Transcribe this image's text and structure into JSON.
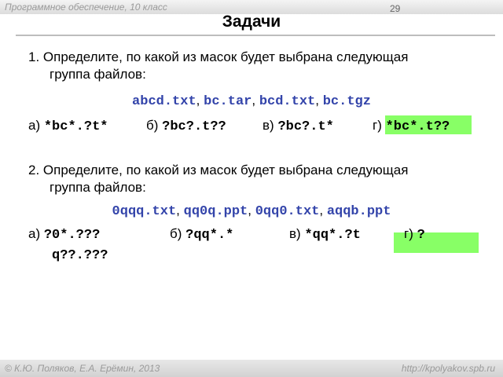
{
  "header": {
    "course": "Программное обеспечение, 10 класс",
    "slide_number": "29",
    "title": "Задачи"
  },
  "task1": {
    "question_line1": "1. Определите, по какой из масок будет выбрана следующая",
    "question_line2": "группа файлов:",
    "files": [
      "abcd.txt",
      "bc.tar",
      "bcd.txt",
      "bc.tgz"
    ],
    "separator": ",",
    "answers": [
      {
        "letter": "а)",
        "mask": "*bc*.?t*"
      },
      {
        "letter": "б)",
        "mask": "?bc?.t??"
      },
      {
        "letter": "в)",
        "mask": "?bc?.t*"
      },
      {
        "letter": "г)",
        "mask": "*bc*.t??"
      }
    ],
    "highlight_color": "#88ff66"
  },
  "task2": {
    "question_line1": "2. Определите, по какой из масок будет выбрана следующая",
    "question_line2": "группа файлов:",
    "files": [
      "0qqq.txt",
      "qq0q.ppt",
      "0qq0.txt",
      "aqqb.ppt"
    ],
    "separator": ",",
    "answers": [
      {
        "letter": "а)",
        "mask": "?0*.???"
      },
      {
        "letter": "б)",
        "mask": "?qq*.*"
      },
      {
        "letter": "в)",
        "mask": "*qq*.?t"
      },
      {
        "letter": "г)",
        "mask": "?"
      },
      {
        "letter": "",
        "mask": "q??.???"
      }
    ],
    "highlight_color": "#88ff66"
  },
  "footer": {
    "authors": "© К.Ю. Поляков, Е.А. Ерёмин, 2013",
    "url": "http://kpolyakov.spb.ru"
  }
}
